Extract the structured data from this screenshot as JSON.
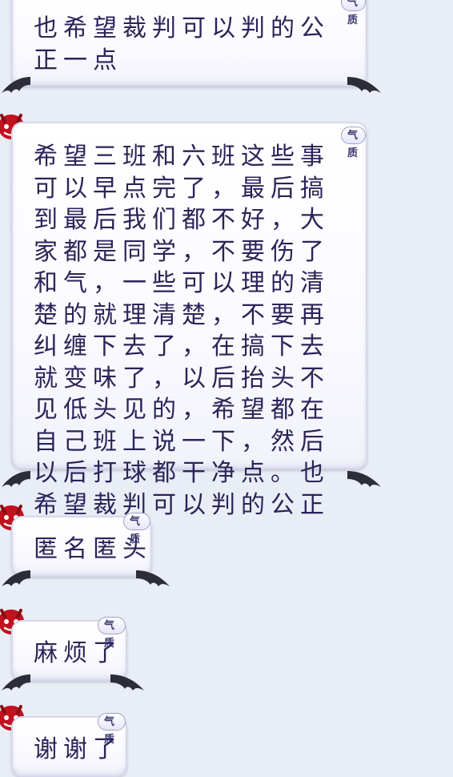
{
  "chat": {
    "messages": [
      {
        "text": "也希望裁判可以判的公正一点",
        "tag": "气质",
        "devil_icon": "devil-trident-icon",
        "wing_icon": "bat-wing-icon"
      },
      {
        "text": "希望三班和六班这些事可以早点完了，最后搞到最后我们都不好，大家都是同学，不要伤了和气，一些可以理的清楚的就理清楚，不要再纠缠下去了，在搞下去就变味了，以后抬头不见低头见的，希望都在自己班上说一下，然后以后打球都干净点。也希望裁判可以判的公正一点。",
        "tag": "气质",
        "devil_icon": "devil-trident-icon",
        "wing_icon": "bat-wing-icon"
      },
      {
        "text": "匿名匿头",
        "tag": "气质",
        "devil_icon": "devil-trident-icon",
        "wing_icon": "bat-wing-icon"
      },
      {
        "text": "麻烦了",
        "tag": "气质",
        "devil_icon": "devil-trident-icon",
        "wing_icon": "bat-wing-icon"
      },
      {
        "text": "谢谢了",
        "tag": "气质",
        "devil_icon": "devil-trident-icon",
        "wing_icon": "bat-wing-icon"
      }
    ]
  },
  "colors": {
    "background": "#e9edf5",
    "bubble_text": "#2a2458",
    "devil_red": "#c1121f",
    "wing_dark": "#2d2d3a"
  }
}
